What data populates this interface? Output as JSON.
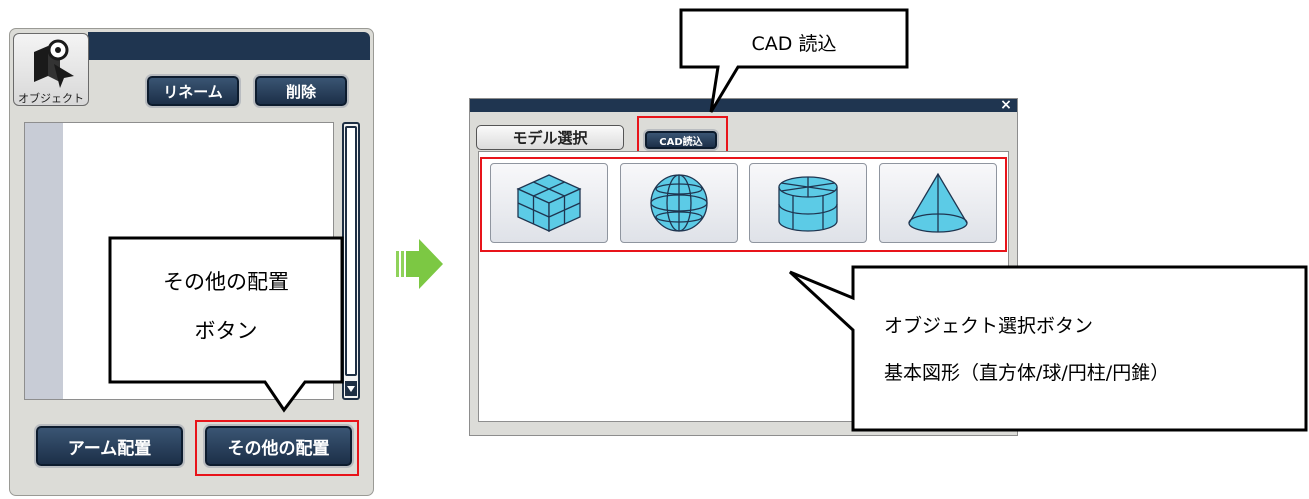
{
  "left_panel": {
    "object_tab_label": "オブジェクト",
    "rename_button": "リネーム",
    "delete_button": "削除",
    "arm_button": "アーム配置",
    "other_button": "その他の配置"
  },
  "dialog": {
    "close_glyph": "×",
    "model_tab": "モデル選択",
    "cad_button": "CAD読込",
    "shapes": [
      {
        "name": "cube-icon"
      },
      {
        "name": "sphere-icon"
      },
      {
        "name": "cylinder-icon"
      },
      {
        "name": "cone-icon"
      }
    ]
  },
  "callouts": {
    "cad": "CAD 読込",
    "other_line1": "その他の配置",
    "other_line2": "ボタン",
    "object_line1": "オブジェクト選択ボタン",
    "object_line2": "基本図形（直方体/球/円柱/円錐）"
  },
  "colors": {
    "title_bar": "#1f3550",
    "highlight": "#e8141a",
    "arrow": "#7cc843",
    "shape_fill": "#5ccbe6"
  }
}
